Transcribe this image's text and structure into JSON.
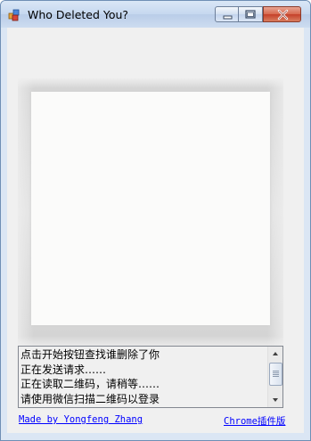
{
  "window": {
    "title": "Who Deleted You?",
    "app_icon": "app-window-icon"
  },
  "title_buttons": {
    "minimize_icon": "minimize-icon",
    "maximize_icon": "maximize-icon",
    "close_icon": "close-icon"
  },
  "qr": {
    "placeholder_icon": "qr-code-image"
  },
  "log": {
    "lines": [
      "点击开始按钮查找谁删除了你",
      "正在发送请求……",
      "正在读取二维码，请稍等……",
      "请使用微信扫描二维码以登录"
    ]
  },
  "footer": {
    "author_link": "Made by Yongfeng Zhang",
    "chrome_link": "Chrome插件版"
  },
  "colors": {
    "link": "#0000ff",
    "close_button": "#c5402a",
    "client_bg": "#f0f0f0"
  }
}
